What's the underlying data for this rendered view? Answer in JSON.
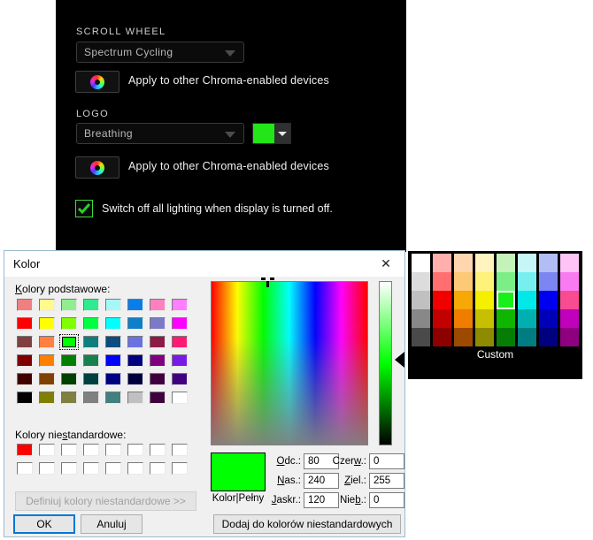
{
  "razer": {
    "scroll_wheel": {
      "section_label": "SCROLL WHEEL",
      "effect": "Spectrum Cycling",
      "apply_text": "Apply to other Chroma-enabled devices",
      "chroma_icon": "chroma-ring-icon",
      "caret_icon": "chevron-down-icon"
    },
    "logo": {
      "section_label": "LOGO",
      "effect": "Breathing",
      "apply_text": "Apply to other Chroma-enabled devices",
      "color_value": "#22e617",
      "chroma_icon": "chroma-ring-icon",
      "caret_icon": "chevron-down-icon"
    },
    "switch_off": {
      "label": "Switch off all lighting when display is turned off.",
      "checked": true,
      "check_icon": "check-mark-icon"
    }
  },
  "dialog": {
    "title": "Kolor",
    "close_icon": "close-icon",
    "basic_label": "Kolory podstawowe:",
    "basic_label_accel": "K",
    "custom_label": "Kolory niestandardowe:",
    "custom_label_accel": "s",
    "basic_colors": [
      [
        "#f08080",
        "#fffa8a",
        "#90ee90",
        "#2eeb8f",
        "#a6f8f8",
        "#0a7ee8",
        "#ff80c0",
        "#ff80ff"
      ],
      [
        "#ff0000",
        "#ffff00",
        "#80ff00",
        "#00ff40",
        "#00ffff",
        "#0e7fc8",
        "#7b79c8",
        "#ff00ff"
      ],
      [
        "#80403f",
        "#ff8040",
        "#00ff00",
        "#117e7e",
        "#0a4d80",
        "#6a72e0",
        "#8e1a47",
        "#ff1a73"
      ],
      [
        "#800000",
        "#ff8000",
        "#008000",
        "#18804e",
        "#0000ff",
        "#000080",
        "#800080",
        "#7a1ae8"
      ],
      [
        "#400000",
        "#804000",
        "#004000",
        "#004040",
        "#000080",
        "#00003f",
        "#400040",
        "#400080"
      ],
      [
        "#000000",
        "#808000",
        "#808040",
        "#808080",
        "#408080",
        "#c0c0c0",
        "#400040",
        "#ffffff"
      ]
    ],
    "selected_basic": {
      "row": 2,
      "col": 2
    },
    "custom_colors": [
      [
        "#ff0000",
        "#ffffff",
        "#ffffff",
        "#ffffff",
        "#ffffff",
        "#ffffff",
        "#ffffff",
        "#ffffff"
      ],
      [
        "#ffffff",
        "#ffffff",
        "#ffffff",
        "#ffffff",
        "#ffffff",
        "#ffffff",
        "#ffffff",
        "#ffffff"
      ]
    ],
    "define_button": "Definiuj kolory niestandardowe >>",
    "define_button_accel": "D",
    "define_button_enabled": false,
    "ok_button": "OK",
    "cancel_button": "Anuluj",
    "add_button": "Dodaj do kolorów niestandardowych",
    "add_button_accel": "D",
    "preview_label": "Kolor|Pełny",
    "preview_color": "#00ff00",
    "fields": {
      "hue": {
        "label": "Odc.:",
        "accel": "O",
        "value": "80"
      },
      "sat": {
        "label": "Nas.:",
        "accel": "N",
        "value": "240"
      },
      "lum": {
        "label": "Jaskr.:",
        "accel": "J",
        "value": "120"
      },
      "red": {
        "label": "Czerw.:",
        "accel": "w",
        "value": "0"
      },
      "green": {
        "label": "Ziel.:",
        "accel": "Z",
        "value": "255"
      },
      "blue": {
        "label": "Nieb.:",
        "accel": "b",
        "value": "0"
      }
    }
  },
  "custom_palette": {
    "label": "Custom",
    "rows": [
      [
        "#ffffff",
        "#ffb0ac",
        "#ffd6ad",
        "#fff4c0",
        "#c4f3ba",
        "#c6f6f8",
        "#b3bdf5",
        "#ffc3f5"
      ],
      [
        "#dcdcdc",
        "#ff6f6f",
        "#fcca76",
        "#fff27a",
        "#7bef86",
        "#77efef",
        "#7b86f2",
        "#f97bf2"
      ],
      [
        "#c0c0c0",
        "#f10000",
        "#f5a806",
        "#f5ef00",
        "#19f019",
        "#00e8e8",
        "#0000f0",
        "#f94b92"
      ],
      [
        "#888888",
        "#c20000",
        "#f07d00",
        "#c6c000",
        "#0fb600",
        "#00b0b0",
        "#0000b8",
        "#c000bb"
      ],
      [
        "#4a4a4a",
        "#8d0000",
        "#9c4a00",
        "#8d8b00",
        "#067e06",
        "#007d83",
        "#000080",
        "#8e0080"
      ]
    ],
    "selected": {
      "row": 2,
      "col": 4
    }
  }
}
